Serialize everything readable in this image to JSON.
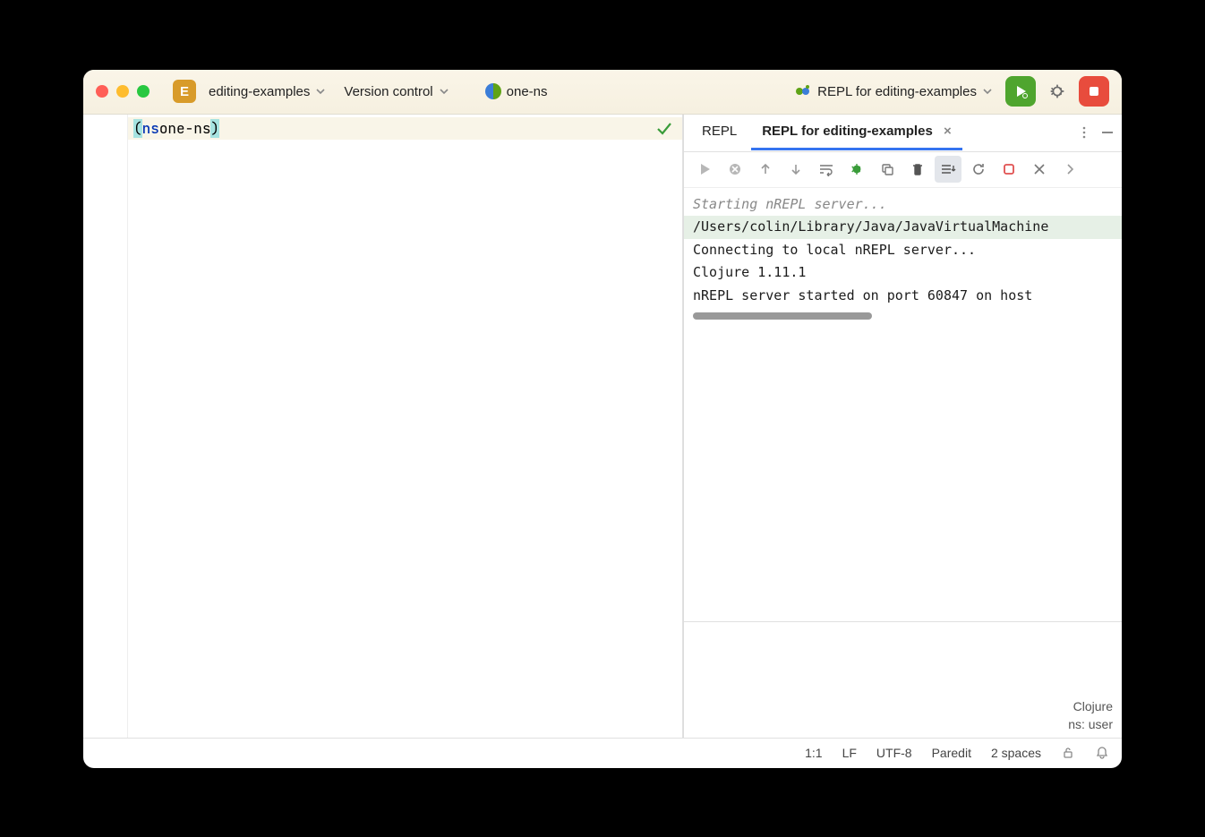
{
  "titlebar": {
    "project_badge": "E",
    "project_name": "editing-examples",
    "version_control": "Version control",
    "file_tab": "one-ns",
    "run_config": "REPL for editing-examples"
  },
  "editor": {
    "code": {
      "paren_open": "(",
      "keyword": "ns",
      "space": " ",
      "symbol": "one-ns",
      "paren_close": ")"
    }
  },
  "repl_tabs": {
    "tab1": "REPL",
    "tab2": "REPL for editing-examples"
  },
  "repl_output": {
    "l1": "Starting nREPL server...",
    "l2": "/Users/colin/Library/Java/JavaVirtualMachine",
    "l3": "Connecting to local nREPL server...",
    "l4": "Clojure 1.11.1",
    "l5": "nREPL server started on port 60847 on host "
  },
  "repl_meta": {
    "lang": "Clojure",
    "ns": "ns: user"
  },
  "statusbar": {
    "pos": "1:1",
    "sep": "LF",
    "enc": "UTF-8",
    "mode": "Paredit",
    "indent": "2 spaces"
  }
}
